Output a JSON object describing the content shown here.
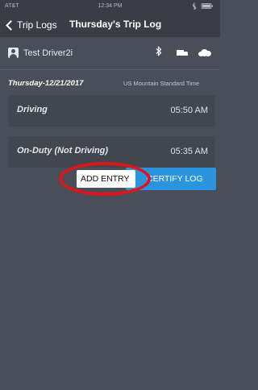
{
  "status_bar": {
    "carrier": "AT&T",
    "time": "12:34 PM"
  },
  "nav": {
    "back_label": "Trip Logs",
    "title": "Thursday's Trip Log"
  },
  "driver": {
    "name": "Test Driver2i"
  },
  "log": {
    "date": "Thursday-12/21/2017",
    "timezone": "US Mountain Standard Time",
    "entries": [
      {
        "status": "Driving",
        "time": "05:50 AM"
      },
      {
        "status": "On-Duty (Not Driving)",
        "time": "05:35 AM"
      }
    ]
  },
  "actions": {
    "add_entry_label": "ADD ENTRY",
    "certify_log_label": "CERTIFY LOG"
  },
  "colors": {
    "background": "#4a4e58",
    "nav_background": "#3a3d45",
    "accent": "#2b94df",
    "highlight_ring": "#e0151a"
  },
  "icons": [
    "signal-icon",
    "wifi-icon",
    "bluetooth-icon",
    "battery-icon",
    "avatar-icon",
    "truck-icon",
    "cloud-icon",
    "back-chevron-icon"
  ]
}
